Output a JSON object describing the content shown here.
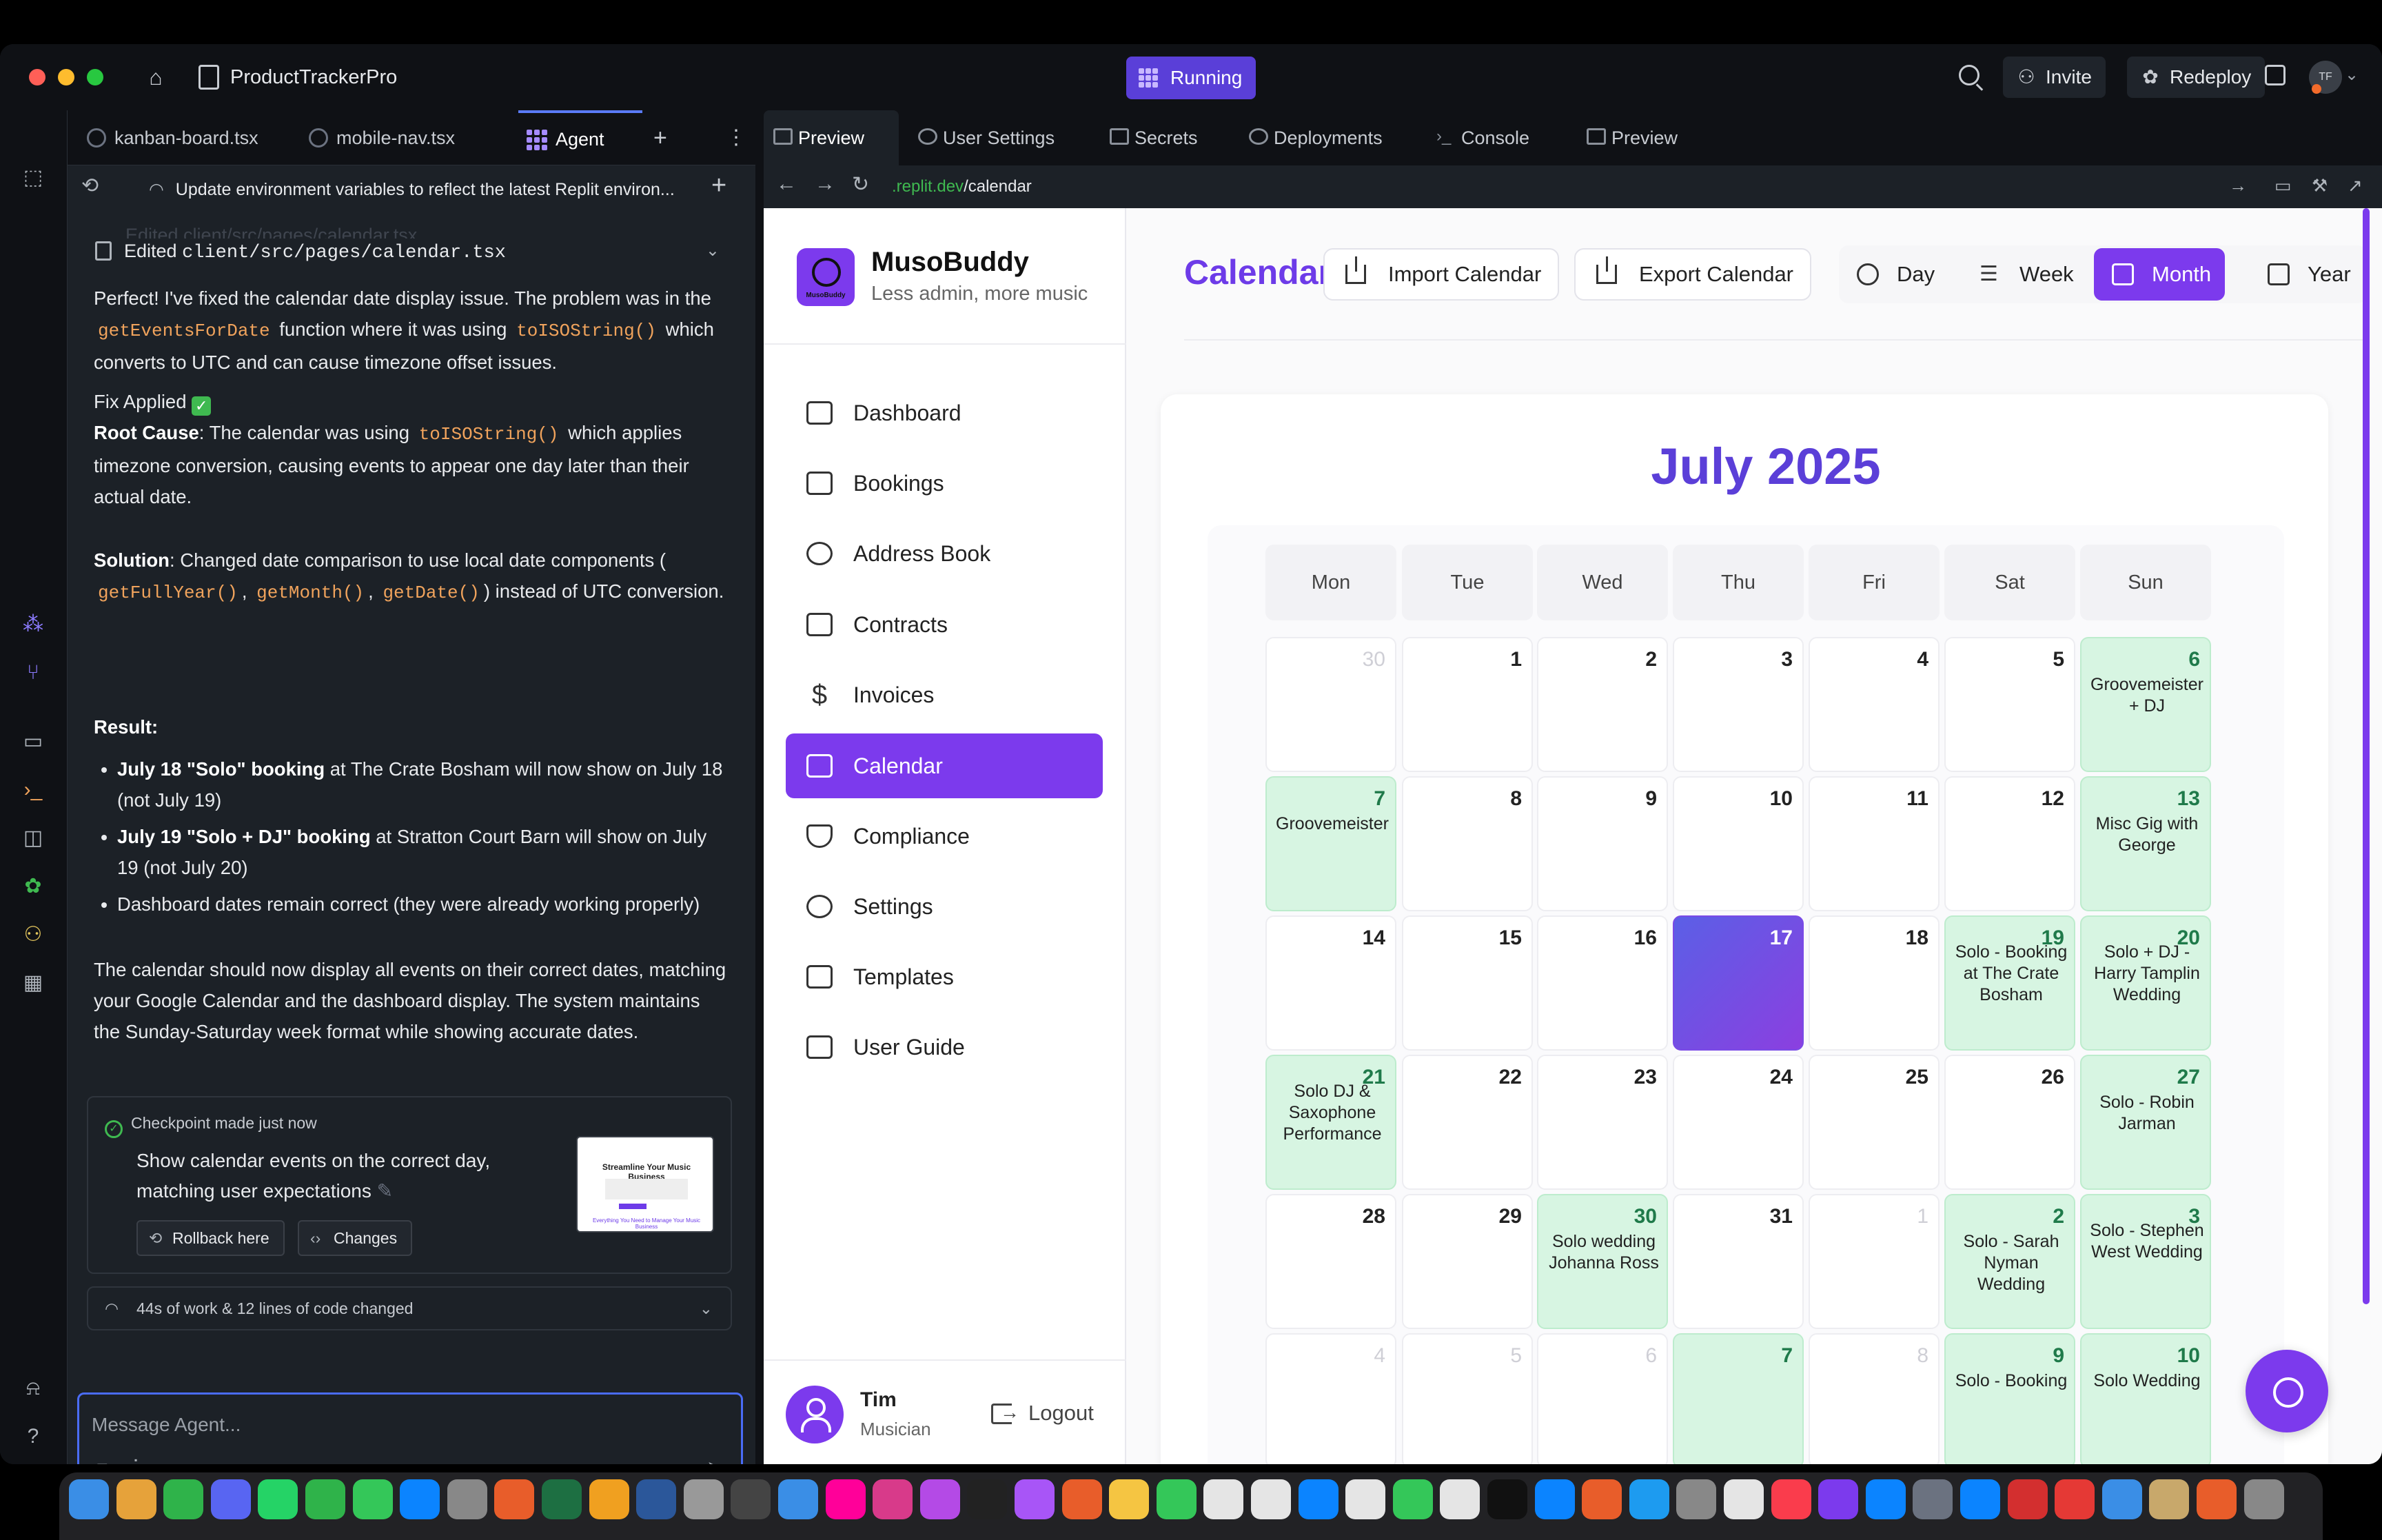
{
  "titlebar": {
    "app_title": "ProductTrackerPro",
    "status": "Running",
    "invite": "Invite",
    "redeploy": "Redeploy",
    "avatar_initials": "TF"
  },
  "agent": {
    "tabs": [
      "kanban-board.tsx",
      "mobile-nav.tsx",
      "Agent"
    ],
    "task_title": "Update environment variables to reflect the latest Replit environ...",
    "edited_faded": "Edited client/src/pages/calendar.tsx",
    "edited_label": "Edited",
    "edited_path": "client/src/pages/calendar.tsx",
    "msg1_a": "Perfect! I've fixed the calendar date display issue. The problem was in the",
    "msg1_code1": "getEventsForDate",
    "msg1_b": "function where it was using",
    "msg1_code2": "toISOString()",
    "msg1_c": "which converts to UTC and can cause timezone offset issues.",
    "fix_applied": "Fix Applied",
    "root_cause_label": "Root Cause",
    "root_cause_a": ": The calendar was using",
    "root_cause_code": "toISOString()",
    "root_cause_b": "which applies timezone conversion, causing events to appear one day later than their actual date.",
    "solution_label": "Solution",
    "solution_a": ": Changed date comparison to use local date components (",
    "solution_code1": "getFullYear()",
    "solution_code2": "getMonth()",
    "solution_code3": "getDate()",
    "solution_b": ") instead of UTC conversion.",
    "result_label": "Result:",
    "bullet1_b": "July 18 \"Solo\" booking",
    "bullet1_t": "at The Crate Bosham will now show on July 18 (not July 19)",
    "bullet2_b": "July 19 \"Solo + DJ\" booking",
    "bullet2_t": "at Stratton Court Barn will show on July 19 (not July 20)",
    "bullet3": "Dashboard dates remain correct (they were already working properly)",
    "closing": "The calendar should now display all events on their correct dates, matching your Google Calendar and the dashboard display. The system maintains the Sunday-Saturday week format while showing accurate dates.",
    "checkpoint_head": "Checkpoint made just now",
    "checkpoint_text": "Show calendar events on the correct day, matching user expectations",
    "thumb_title": "Streamline Your Music Business",
    "thumb_foot": "Everything You Need to Manage Your Music Business",
    "rollback": "Rollback here",
    "changes": "Changes",
    "work_summary": "44s of work & 12 lines of code changed",
    "composer_placeholder": "Message Agent..."
  },
  "right_tabs": [
    "Preview",
    "User Settings",
    "Secrets",
    "Deployments",
    "Console",
    "Preview"
  ],
  "url": {
    "domain": ".replit.dev",
    "path": "/calendar"
  },
  "app": {
    "brand_name": "MusoBuddy",
    "brand_tag": "Less admin, more music",
    "logo_text": "MusoBuddy",
    "nav": [
      "Dashboard",
      "Bookings",
      "Address Book",
      "Contracts",
      "Invoices",
      "Calendar",
      "Compliance",
      "Settings",
      "Templates",
      "User Guide"
    ],
    "user_name": "Tim",
    "user_role": "Musician",
    "logout": "Logout"
  },
  "calendar": {
    "title": "Calendar",
    "import": "Import Calendar",
    "export": "Export Calendar",
    "views": [
      "Day",
      "Week",
      "Month",
      "Year"
    ],
    "active_view": "Month",
    "month_title": "July 2025",
    "weekdays": [
      "Mon",
      "Tue",
      "Wed",
      "Thu",
      "Fri",
      "Sat",
      "Sun"
    ],
    "weeks": [
      [
        {
          "n": "30",
          "o": true
        },
        {
          "n": "1"
        },
        {
          "n": "2"
        },
        {
          "n": "3"
        },
        {
          "n": "4"
        },
        {
          "n": "5"
        },
        {
          "n": "6",
          "e": "Groovemeister + DJ"
        }
      ],
      [
        {
          "n": "7",
          "e": "Groovemeister"
        },
        {
          "n": "8"
        },
        {
          "n": "9"
        },
        {
          "n": "10"
        },
        {
          "n": "11"
        },
        {
          "n": "12"
        },
        {
          "n": "13",
          "e": "Misc Gig with George"
        }
      ],
      [
        {
          "n": "14"
        },
        {
          "n": "15"
        },
        {
          "n": "16"
        },
        {
          "n": "17",
          "t": true
        },
        {
          "n": "18"
        },
        {
          "n": "19",
          "e": "Solo - Booking at The Crate Bosham"
        },
        {
          "n": "20",
          "e": "Solo + DJ - Harry Tamplin Wedding"
        }
      ],
      [
        {
          "n": "21",
          "e": "Solo DJ & Saxophone Performance"
        },
        {
          "n": "22"
        },
        {
          "n": "23"
        },
        {
          "n": "24"
        },
        {
          "n": "25"
        },
        {
          "n": "26"
        },
        {
          "n": "27",
          "e": "Solo - Robin Jarman"
        }
      ],
      [
        {
          "n": "28"
        },
        {
          "n": "29"
        },
        {
          "n": "30",
          "e": "Solo wedding Johanna Ross"
        },
        {
          "n": "31"
        },
        {
          "n": "1",
          "o": true
        },
        {
          "n": "2",
          "e": "Solo - Sarah Nyman Wedding"
        },
        {
          "n": "3",
          "e": "Solo - Stephen West Wedding"
        }
      ],
      [
        {
          "n": "4",
          "o": true
        },
        {
          "n": "5",
          "o": true
        },
        {
          "n": "6",
          "o": true
        },
        {
          "n": "7",
          "e": ""
        },
        {
          "n": "8",
          "o": true
        },
        {
          "n": "9",
          "e": "Solo - Booking"
        },
        {
          "n": "10",
          "e": "Solo Wedding"
        }
      ]
    ]
  },
  "colors": {
    "accent": "#7c3aed",
    "event_bg": "#d7f5e2",
    "running": "#5a3fd8"
  }
}
